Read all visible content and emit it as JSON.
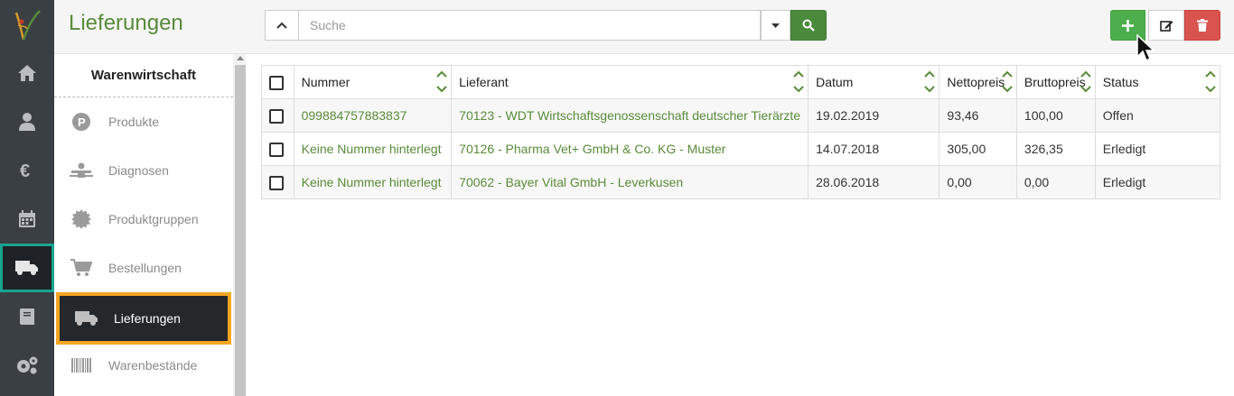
{
  "app": {
    "page_title": "Lieferungen",
    "accent_color": "#5a8a3a",
    "rail_active_border": "#18a58c",
    "sidebar_active_border": "#f5a623"
  },
  "rail": {
    "items": [
      {
        "icon": "home-icon"
      },
      {
        "icon": "user-medical-icon"
      },
      {
        "icon": "euro-icon"
      },
      {
        "icon": "calendar-icon"
      },
      {
        "icon": "truck-icon"
      },
      {
        "icon": "book-icon"
      },
      {
        "icon": "gears-icon"
      }
    ]
  },
  "search": {
    "placeholder": "Suche",
    "value": ""
  },
  "sidebar": {
    "title": "Warenwirtschaft",
    "items": [
      {
        "label": "Produkte",
        "icon": "product-p-icon"
      },
      {
        "label": "Diagnosen",
        "icon": "diagnosis-icon"
      },
      {
        "label": "Produktgruppen",
        "icon": "cog-badge-icon"
      },
      {
        "label": "Bestellungen",
        "icon": "cart-icon"
      },
      {
        "label": "Lieferungen",
        "icon": "truck-icon"
      },
      {
        "label": "Warenbestände",
        "icon": "barcode-icon"
      }
    ]
  },
  "table": {
    "columns": [
      "Nummer",
      "Lieferant",
      "Datum",
      "Nettopreis",
      "Bruttopreis",
      "Status"
    ],
    "rows": [
      {
        "nummer": "099884757883837",
        "lieferant": "70123 - WDT Wirtschaftsgenossenschaft deutscher Tierärzte",
        "datum": "19.02.2019",
        "netto": "93,46",
        "brutto": "100,00",
        "status": "Offen"
      },
      {
        "nummer": "Keine Nummer hinterlegt",
        "lieferant": "70126 - Pharma Vet+ GmbH & Co. KG - Muster",
        "datum": "14.07.2018",
        "netto": "305,00",
        "brutto": "326,35",
        "status": "Erledigt"
      },
      {
        "nummer": "Keine Nummer hinterlegt",
        "lieferant": "70062 - Bayer Vital GmbH - Leverkusen",
        "datum": "28.06.2018",
        "netto": "0,00",
        "brutto": "0,00",
        "status": "Erledigt"
      }
    ]
  }
}
